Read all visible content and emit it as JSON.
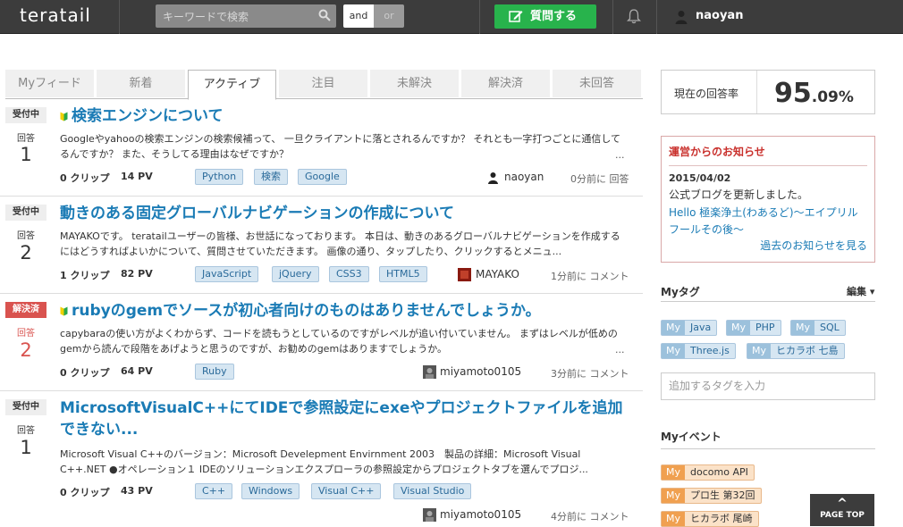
{
  "header": {
    "logo": "teratail",
    "search_placeholder": "キーワードで検索",
    "and_label": "and",
    "or_label": "or",
    "ask_label": "質問する",
    "user_name": "naoyan"
  },
  "tabs": [
    "Myフィード",
    "新着",
    "アクティブ",
    "注目",
    "未解決",
    "解決済",
    "未回答"
  ],
  "active_tab": "アクティブ",
  "questions": [
    {
      "status": "受付中",
      "answer_label": "回答",
      "answers": "1",
      "title": "検索エンジンについて",
      "excerpt": "Googleやyahooの検索エンジンの検索候補って、 一旦クライアントに落とされるんですか？ それとも一字打つごとに通信してるんですか？ また、そうしてる理由はなぜですか？",
      "clips": "0 クリップ",
      "pv": "14 PV",
      "tags": [
        "Python",
        "検索",
        "Google"
      ],
      "author": "naoyan",
      "time": "0分前に 回答"
    },
    {
      "status": "受付中",
      "answer_label": "回答",
      "answers": "2",
      "title": "動きのある固定グローバルナビゲーションの作成について",
      "excerpt": "MAYAKOです。 teratailユーザーの皆様、お世話になっております。 本日は、動きのあるグローバルナビゲーションを作成するにはどうすればよいかについて、質問させていただきます。 画像の通り、タップしたり、クリックするとメニュ...",
      "clips": "1 クリップ",
      "pv": "82 PV",
      "tags": [
        "JavaScript",
        "jQuery",
        "CSS3",
        "HTML5"
      ],
      "author": "MAYAKO",
      "time": "1分前に コメント"
    },
    {
      "status": "解決済",
      "answer_label": "回答",
      "answers": "2",
      "title": "rubyのgemでソースが初心者向けのものはありませんでしょうか。",
      "excerpt": "capybaraの使い方がよくわからず、コードを読もうとしているのですがレベルが追い付いていません。 まずはレベルが低めのgemから読んで段階をあげようと思うのですが、お勧めのgemはありますでしょうか。",
      "clips": "0 クリップ",
      "pv": "64 PV",
      "tags": [
        "Ruby"
      ],
      "author": "miyamoto0105",
      "time": "3分前に コメント"
    },
    {
      "status": "受付中",
      "answer_label": "回答",
      "answers": "1",
      "title": "MicrosoftVisualC++にてIDEで参照設定にexeやプロジェクトファイルを追加できない...",
      "excerpt": "Microsoft Visual C++のバージョン：Microsoft Develepment Envirnment 2003　製品の詳細：Microsoft Visual C++.NET ●オペレーション１ IDEのソリューションエクスプローラの参照設定からプロジェクトタブを選んでプロジ...",
      "clips": "0 クリップ",
      "pv": "43 PV",
      "tags": [
        "C++",
        "Windows",
        "Visual C++",
        "Visual Studio"
      ],
      "author": "miyamoto0105",
      "time": "4分前に コメント"
    }
  ],
  "more_label": "...",
  "sidebar": {
    "rate_label": "現在の回答率",
    "rate_int": "95",
    "rate_dec": ".09%",
    "news_title": "運営からのお知らせ",
    "news_date": "2015/04/02",
    "news_text": "公式ブログを更新しました。",
    "news_link": "Hello 極楽浄土(わあるど)〜エイプリルフールその後〜",
    "news_more": "過去のお知らせを見る",
    "mytag_title": "Myタグ",
    "edit_label": "編集",
    "my_label": "My",
    "mytags": [
      "Java",
      "PHP",
      "SQL",
      "Three.js",
      "ヒカラボ 七島"
    ],
    "tag_input_placeholder": "追加するタグを入力",
    "myevent_title": "Myイベント",
    "events": [
      "docomo API",
      "プロ生 第32回",
      "ヒカラボ 尾崎"
    ]
  },
  "page_top": "PAGE TOP",
  "colors": {
    "header_bg": "#3c3c3c",
    "ask_green": "#28b34c",
    "link_blue": "#1a7bb5",
    "resolved_red": "#d9534f"
  }
}
